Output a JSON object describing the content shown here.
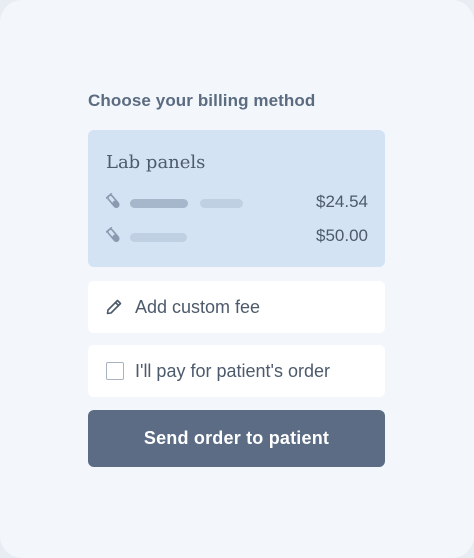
{
  "billing": {
    "title": "Choose your billing method",
    "lab_panels": {
      "title": "Lab panels",
      "items": [
        {
          "icon": "test-tube-icon",
          "price": "$24.54"
        },
        {
          "icon": "test-tube-icon",
          "price": "$50.00"
        }
      ]
    },
    "custom_fee": {
      "icon": "pencil-icon",
      "label": "Add custom fee"
    },
    "pay_option": {
      "label": "I'll pay for patient's order",
      "checked": false
    },
    "send_button": {
      "label": "Send order to patient"
    }
  },
  "colors": {
    "page_bg": "#f3f7fb",
    "lab_box_bg": "#d3e3f4",
    "primary_button": "#5b6c84",
    "text": "#4c5a6c"
  }
}
